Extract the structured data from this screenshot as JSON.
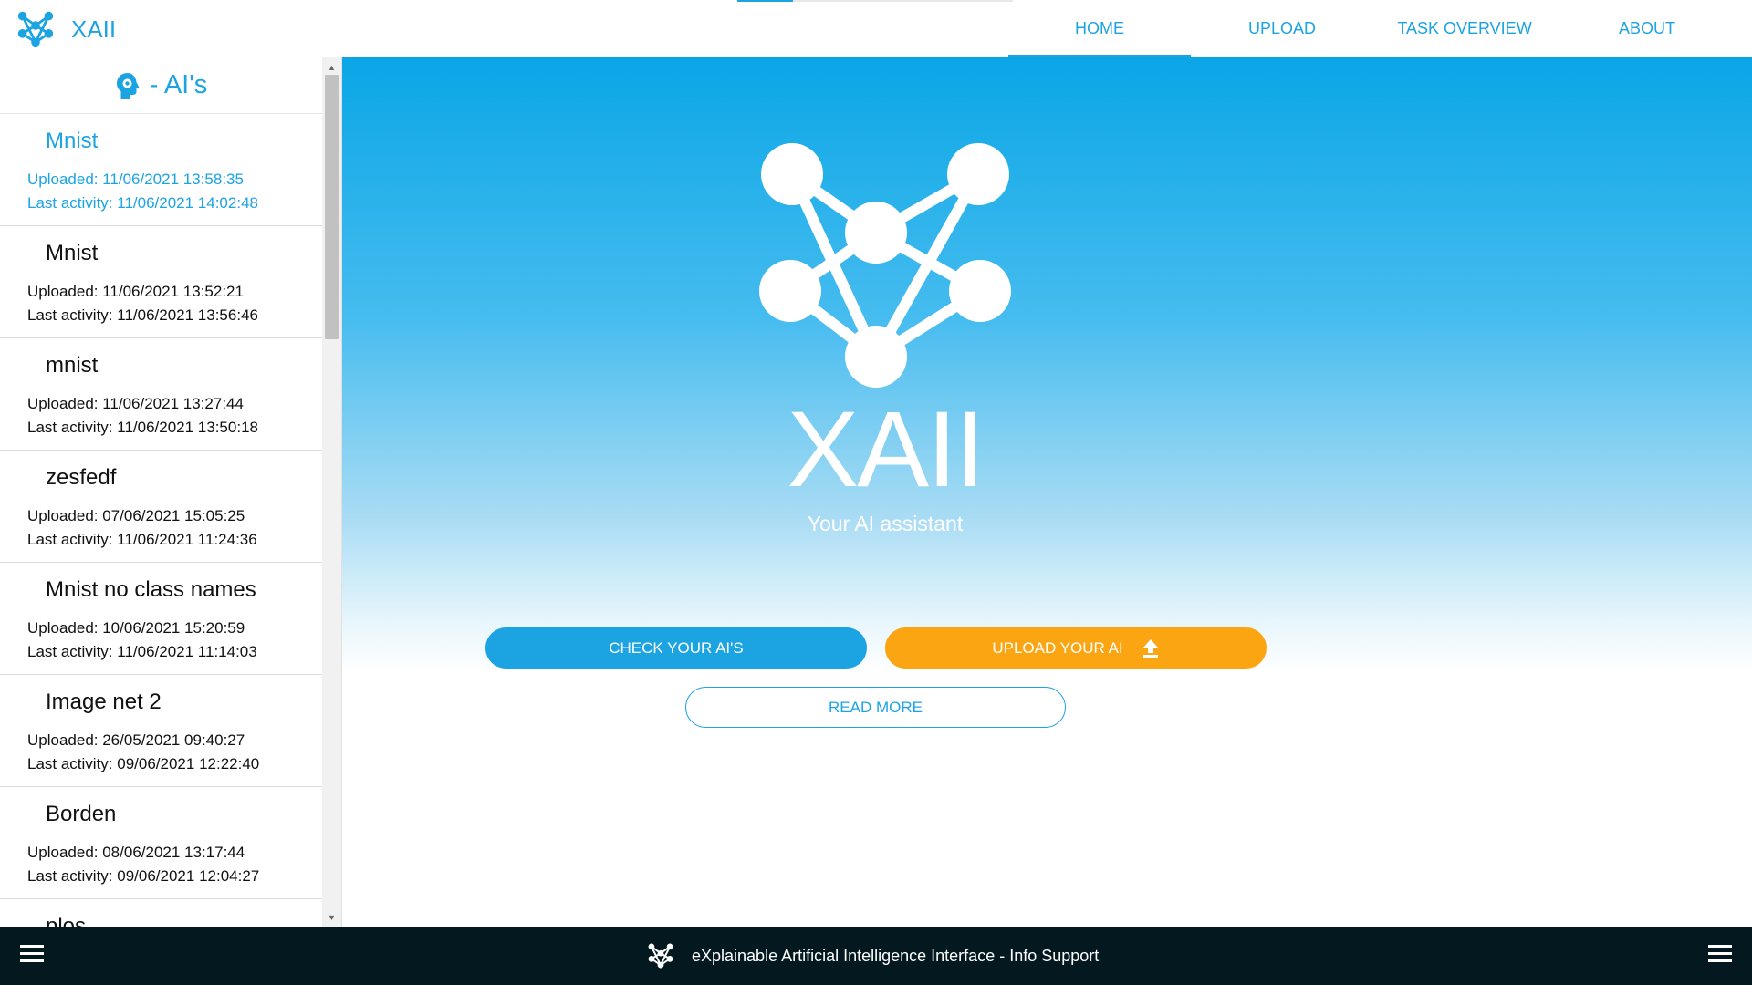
{
  "app": {
    "title": "XAII"
  },
  "nav": {
    "items": [
      {
        "label": "HOME",
        "active": true
      },
      {
        "label": "UPLOAD",
        "active": false
      },
      {
        "label": "TASK OVERVIEW",
        "active": false
      },
      {
        "label": "ABOUT",
        "active": false
      }
    ]
  },
  "sidebar": {
    "title": "- AI's",
    "items": [
      {
        "name": "Mnist",
        "uploaded": "Uploaded: 11/06/2021 13:58:35",
        "last_activity": "Last activity: 11/06/2021 14:02:48",
        "selected": true
      },
      {
        "name": "Mnist",
        "uploaded": "Uploaded: 11/06/2021 13:52:21",
        "last_activity": "Last activity: 11/06/2021 13:56:46",
        "selected": false
      },
      {
        "name": "mnist",
        "uploaded": "Uploaded: 11/06/2021 13:27:44",
        "last_activity": "Last activity: 11/06/2021 13:50:18",
        "selected": false
      },
      {
        "name": "zesfedf",
        "uploaded": "Uploaded: 07/06/2021 15:05:25",
        "last_activity": "Last activity: 11/06/2021 11:24:36",
        "selected": false
      },
      {
        "name": "Mnist no class names",
        "uploaded": "Uploaded: 10/06/2021 15:20:59",
        "last_activity": "Last activity: 11/06/2021 11:14:03",
        "selected": false
      },
      {
        "name": "Image net 2",
        "uploaded": "Uploaded: 26/05/2021 09:40:27",
        "last_activity": "Last activity: 09/06/2021 12:22:40",
        "selected": false
      },
      {
        "name": "Borden",
        "uploaded": "Uploaded: 08/06/2021 13:17:44",
        "last_activity": "Last activity: 09/06/2021 12:04:27",
        "selected": false
      },
      {
        "name": "plos",
        "uploaded": "",
        "last_activity": "",
        "selected": false
      }
    ]
  },
  "hero": {
    "title": "XAII",
    "subtitle": "Your AI assistant",
    "check_button": "CHECK YOUR AI'S",
    "upload_button": "UPLOAD YOUR AI",
    "read_more_button": "READ MORE"
  },
  "footer": {
    "text": "eXplainable Artificial Intelligence Interface - Info Support"
  },
  "colors": {
    "accent": "#1ca4e2",
    "orange": "#fca512",
    "footer": "#04191f"
  },
  "icons": {
    "brand": "network-logo-icon",
    "sidebar_header": "head-gear-icon",
    "upload": "upload-arrow-icon",
    "menu": "hamburger-menu-icon"
  }
}
